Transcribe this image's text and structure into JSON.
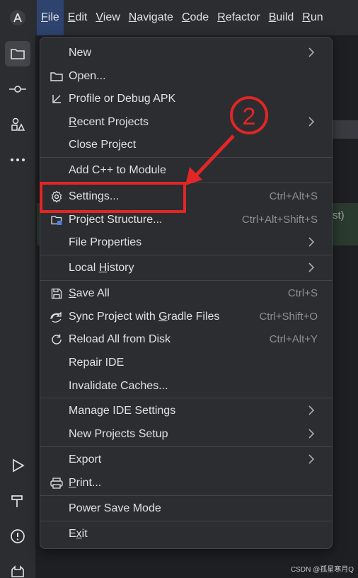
{
  "menubar": {
    "items": [
      {
        "label": "File",
        "key": "F",
        "rest": "ile"
      },
      {
        "label": "Edit",
        "key": "E",
        "rest": "dit"
      },
      {
        "label": "View",
        "key": "V",
        "rest": "iew"
      },
      {
        "label": "Navigate",
        "key": "N",
        "rest": "avigate"
      },
      {
        "label": "Code",
        "key": "C",
        "rest": "ode"
      },
      {
        "label": "Refactor",
        "key": "R",
        "rest": "efactor"
      },
      {
        "label": "Build",
        "key": "B",
        "rest": "uild"
      },
      {
        "label": "Run",
        "key": "R",
        "rest": "un"
      }
    ]
  },
  "file_menu": {
    "new": "New",
    "open": "Open...",
    "profile": "Profile or Debug APK",
    "recent": "Recent Projects",
    "close": "Close Project",
    "add_cpp": "Add C++ to Module",
    "settings": "Settings...",
    "settings_sc": "Ctrl+Alt+S",
    "project_structure": "Project Structure...",
    "project_structure_sc": "Ctrl+Alt+Shift+S",
    "file_properties": "File Properties",
    "local_history": "Local History",
    "save_all": "Save All",
    "save_all_sc": "Ctrl+S",
    "sync": "Sync Project with Gradle Files",
    "sync_sc": "Ctrl+Shift+O",
    "reload": "Reload All from Disk",
    "reload_sc": "Ctrl+Alt+Y",
    "repair": "Repair IDE",
    "invalidate": "Invalidate Caches...",
    "manage_ide": "Manage IDE Settings",
    "new_projects_setup": "New Projects Setup",
    "export": "Export",
    "print": "Print...",
    "power_save": "Power Save Mode",
    "exit": "Exit"
  },
  "annotation": {
    "step": "2",
    "color": "#e02626"
  },
  "background": {
    "fragment": "st)"
  },
  "watermark": "CSDN @孤星寒月Q",
  "colors": {
    "accent": "#2e436e",
    "menu_bg": "#2b2d30",
    "text": "#dfe1e5",
    "shortcut": "#8c9096"
  }
}
